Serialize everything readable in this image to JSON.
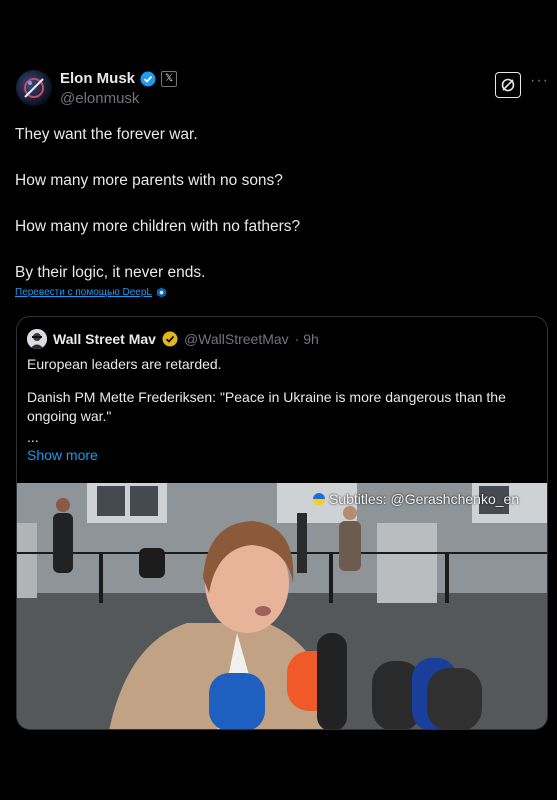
{
  "post": {
    "author_name": "Elon Musk",
    "author_handle": "@elonmusk",
    "x_badge": "𝕏",
    "more": "···",
    "text_lines": [
      "They want the forever war.",
      "How many more parents with no sons?",
      "How many more children with no fathers?",
      "By their logic, it never ends."
    ],
    "translate_label": "Перевести с помощью DeepL"
  },
  "quote": {
    "author_name": "Wall Street Mav",
    "author_handle": "@WallStreetMav",
    "time": "· 9h",
    "text_lines": [
      "European leaders are retarded.",
      "Danish PM Mette Frederiksen:  \"Peace in Ukraine is more dangerous than the ongoing war.\"",
      "..."
    ],
    "show_more": "Show more",
    "video_subtitle": "Subtitles: @Gerashchenko_en"
  },
  "colors": {
    "accent": "#1d9bf0",
    "verified_blue": "#1d9bf0",
    "verified_gold": "#e2b719"
  }
}
